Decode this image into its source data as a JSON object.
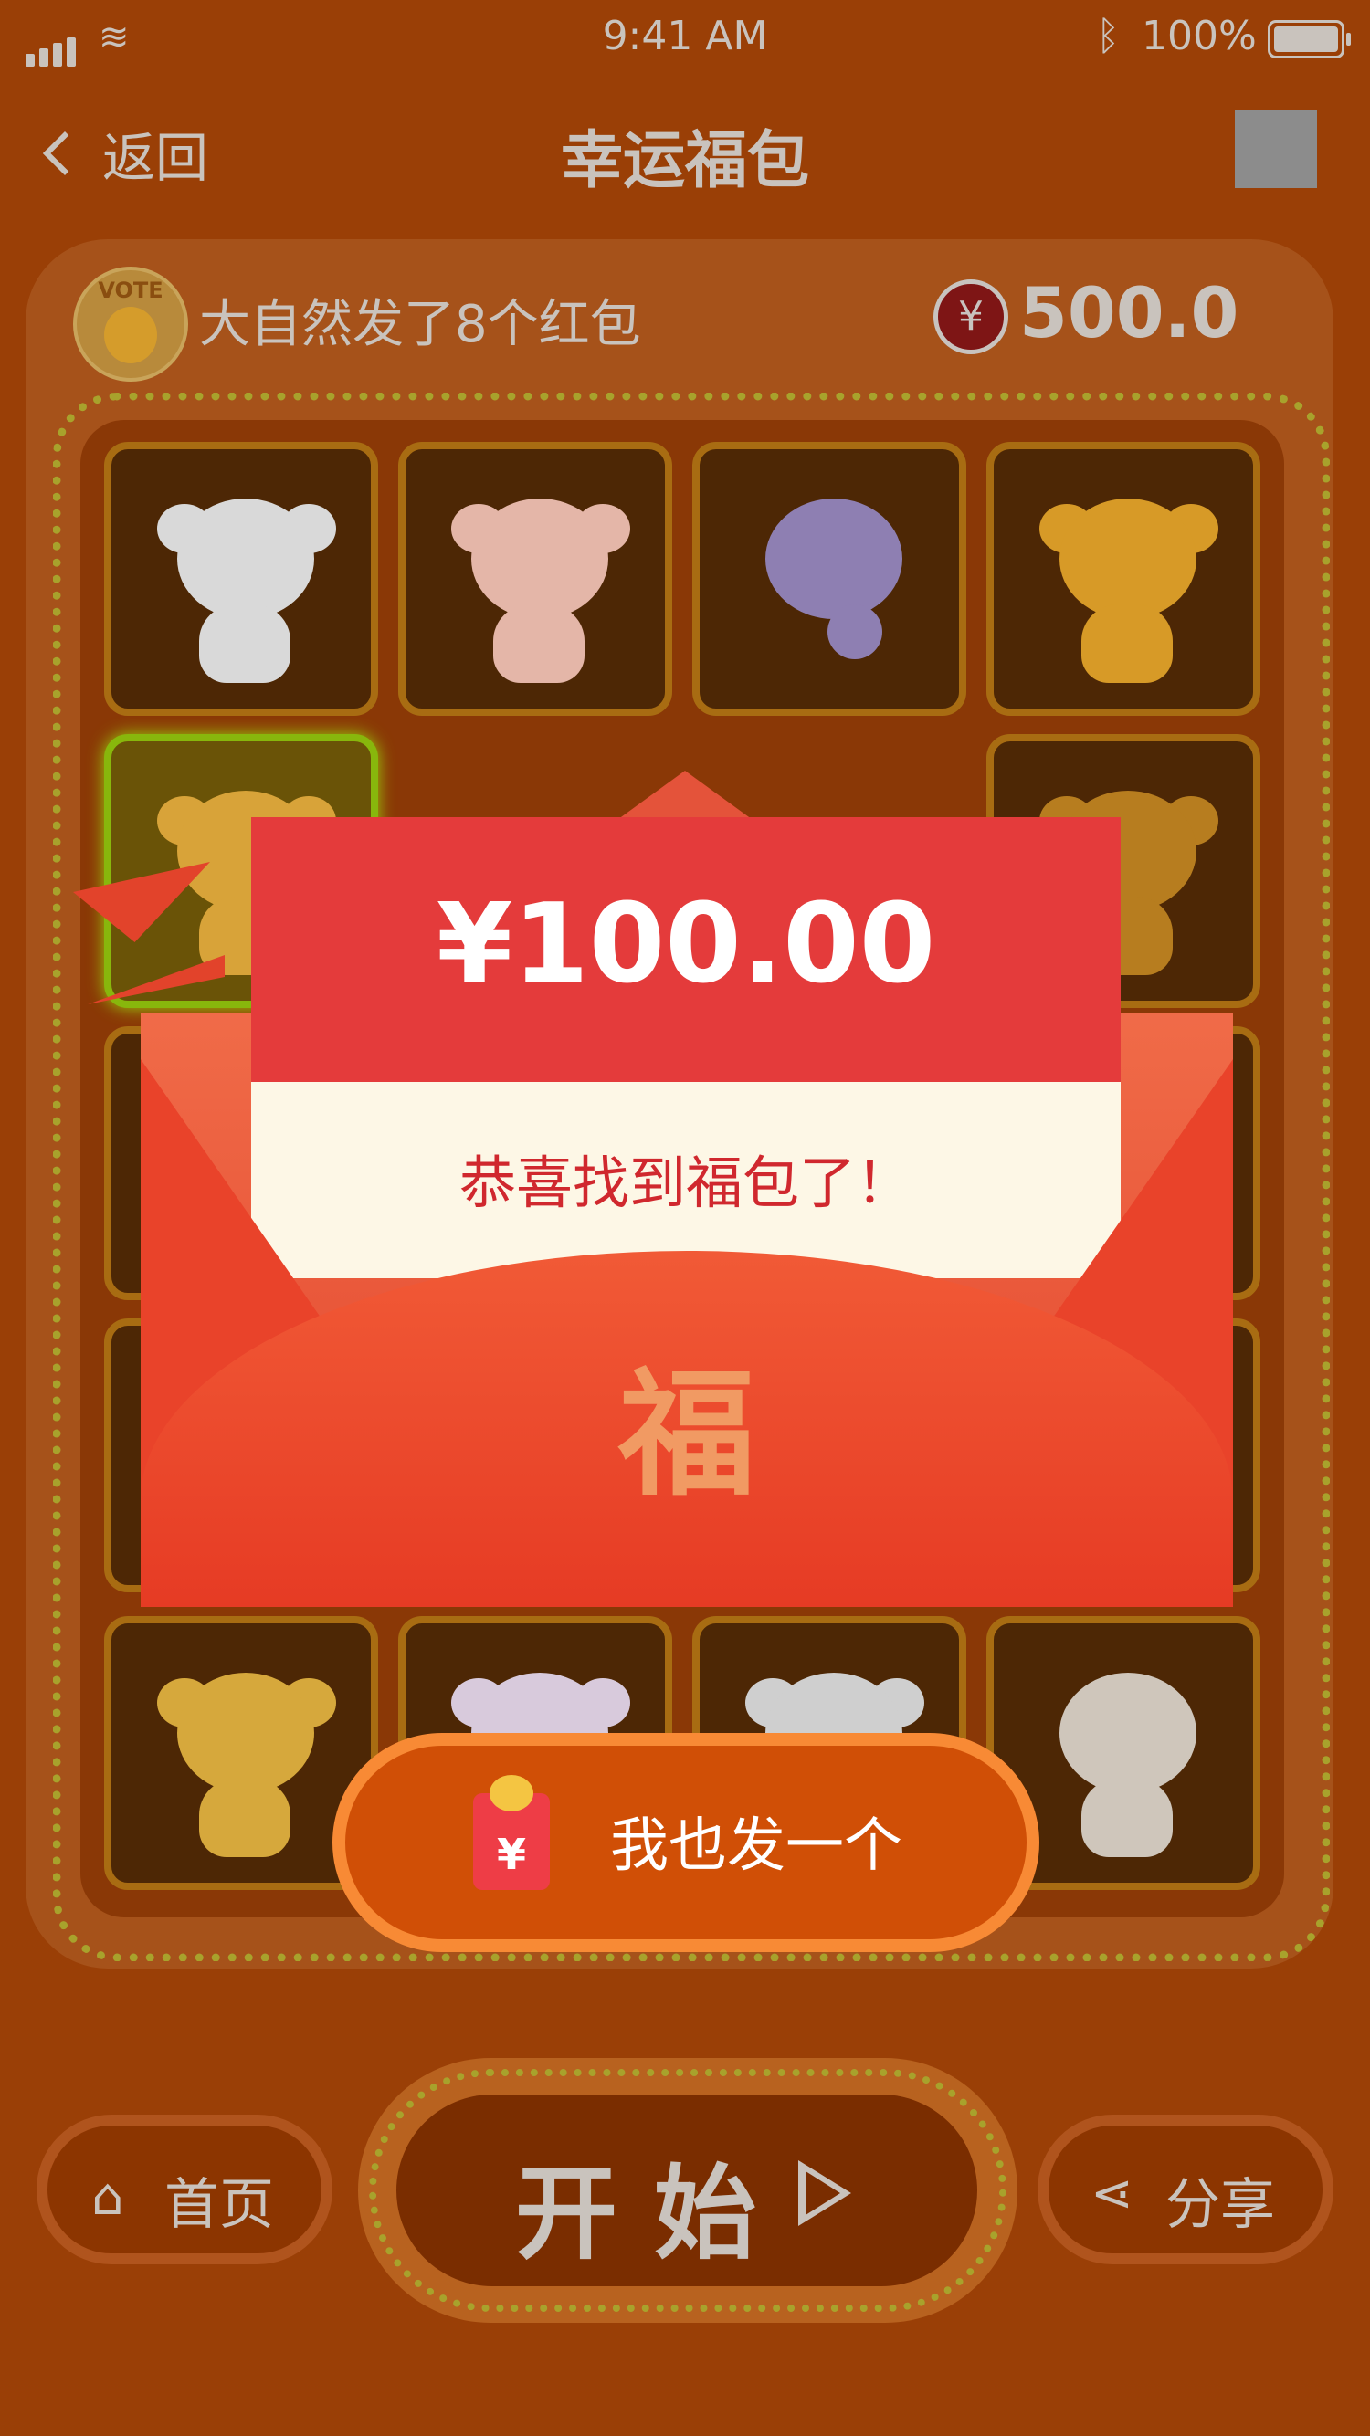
{
  "status_bar": {
    "time": "9:41 AM",
    "battery": "100%"
  },
  "nav": {
    "back_label": "返回",
    "title": "幸运福包"
  },
  "game": {
    "avatar_badge": "VOTE",
    "sender_text": "大自然发了8个红包",
    "balance_symbol": "¥",
    "balance": "500.0"
  },
  "tiles": [
    {
      "name": "monkey",
      "color": "#d9d9d9"
    },
    {
      "name": "pig",
      "color": "#e4b6a8"
    },
    {
      "name": "snake",
      "color": "#8e7fb2"
    },
    {
      "name": "horse",
      "color": "#d79a27"
    },
    {
      "name": "tiger",
      "color": "#d8a339"
    },
    {
      "name": "horse",
      "color": "#b77d1f"
    },
    {
      "name": "dog",
      "color": "#d6a83c"
    },
    {
      "name": "sheep",
      "color": "#d8cadc"
    },
    {
      "name": "monkey",
      "color": "#cfcfcf"
    },
    {
      "name": "rooster",
      "color": "#cfc6bb"
    }
  ],
  "envelope": {
    "amount": "¥100.00",
    "message": "恭喜找到福包了！",
    "seal": "福"
  },
  "send_button": {
    "icon_symbol": "¥",
    "label": "我也发一个"
  },
  "bottom": {
    "home_label": "首页",
    "start_label": "开始",
    "share_label": "分享"
  },
  "colors": {
    "background": "#9a3f06",
    "envelope_red": "#e43b3b",
    "button_orange": "#d04f06",
    "highlight_green": "#88b70c"
  }
}
